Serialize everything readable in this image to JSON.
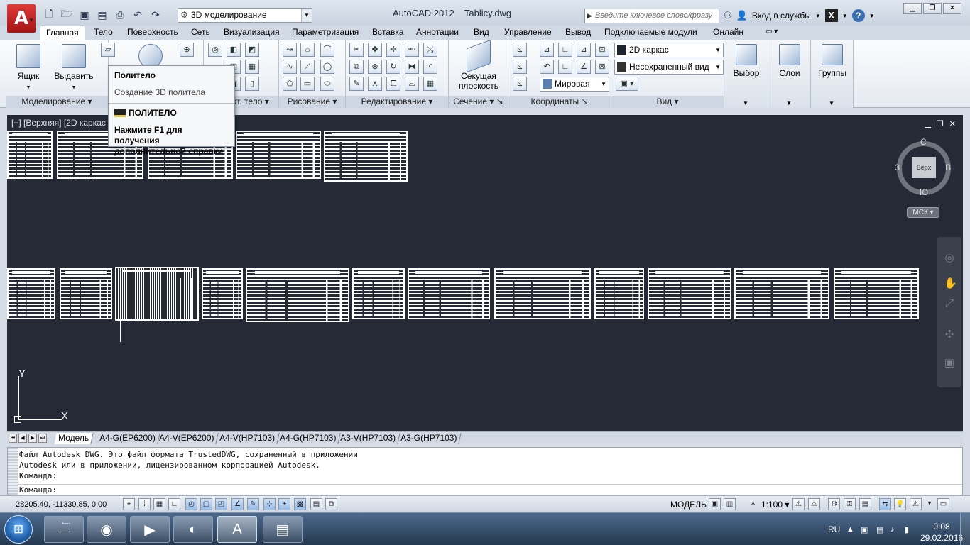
{
  "title_bar": {
    "app_title": "AutoCAD 2012    Tablicy.dwg",
    "workspace": "3D моделирование",
    "search_placeholder": "Введите ключевое слово/фразу",
    "signin": "Вход в службы",
    "logo_letter": "A"
  },
  "ribbon_tabs": [
    "Главная",
    "Тело",
    "Поверхность",
    "Сеть",
    "Визуализация",
    "Параметризация",
    "Вставка",
    "Аннотации",
    "Вид",
    "Управление",
    "Вывод",
    "Подключаемые модули",
    "Онлайн"
  ],
  "ribbon": {
    "panels": {
      "modeling": "Моделирование",
      "solid_edit": "Редакт. тело",
      "draw": "Рисование",
      "modify": "Редактирование",
      "section": "Сечение",
      "coordinates": "Координаты",
      "view": "Вид"
    },
    "buttons": {
      "box": "Ящик",
      "extrude": "Выдавить",
      "section_plane_1": "Секущая",
      "section_plane_2": "плоскость",
      "selection": "Выбор",
      "layers": "Слои",
      "groups": "Группы"
    },
    "visual_style": "2D каркас",
    "named_view": "Несохраненный вид",
    "ucs_world": "Мировая"
  },
  "tooltip": {
    "title": "Политело",
    "description": "Создание 3D политела",
    "command": "ПОЛИТЕЛО",
    "help_line_1": "Нажмите F1 для получения",
    "help_line_2": "дополнительной справки"
  },
  "viewport": {
    "label": "[−] [Верхняя] [2D каркас",
    "compass": {
      "north": "С",
      "south": "Ю",
      "east": "В",
      "west": "З"
    },
    "cube_face": "Верх",
    "wcs": "МСК",
    "axis_x": "X",
    "axis_y": "Y"
  },
  "layout_tabs": [
    "Модель",
    "A4-G(EP6200)",
    "A4-V(EP6200)",
    "A4-V(HP7103)",
    "A4-G(HP7103)",
    "A3-V(HP7103)",
    "A3-G(HP7103)"
  ],
  "command_line": {
    "history_1": "Файл Autodesk DWG. Это файл формата TrustedDWG, сохраненный в приложении",
    "history_2": "Autodesk или в приложении, лицензированном корпорацией Autodesk.",
    "history_3": "Команда:",
    "prompt": "Команда:"
  },
  "status_bar": {
    "coords": "28205.40, -11330.85, 0.00",
    "model": "МОДЕЛЬ",
    "scale": "1:100"
  },
  "taskbar": {
    "language": "RU",
    "time": "0:08",
    "date": "29.02.2016"
  },
  "colors": {
    "canvas": "#252a36",
    "accent_red": "#c4201f",
    "ribbon_bg": "#e5eaf1"
  }
}
